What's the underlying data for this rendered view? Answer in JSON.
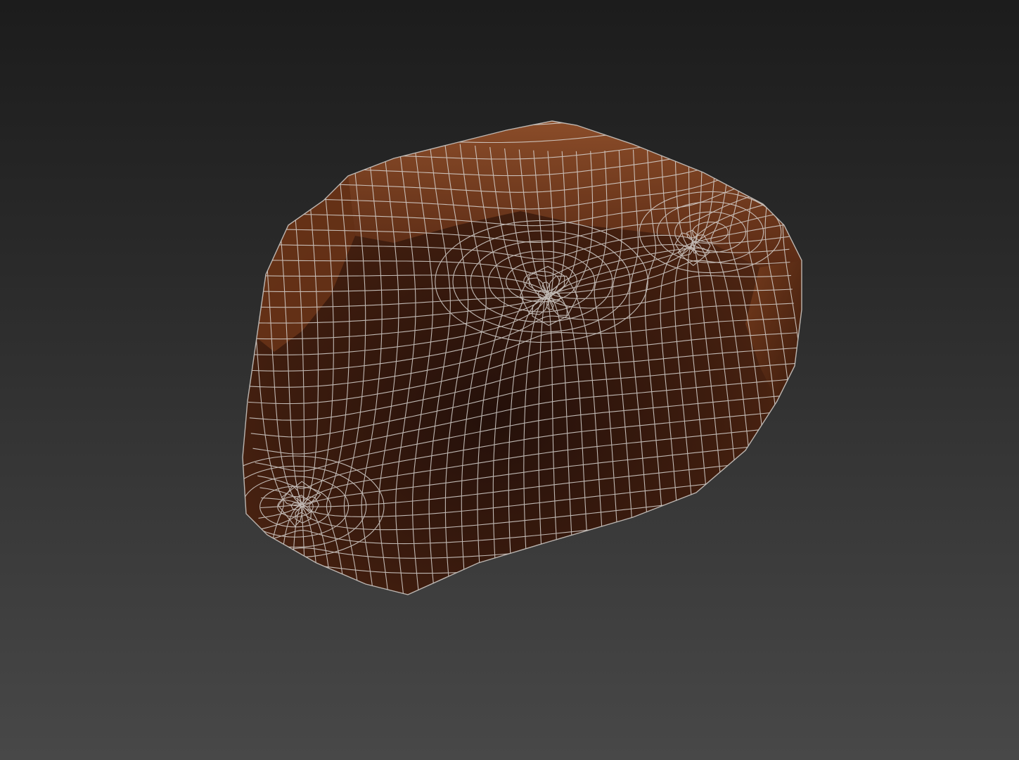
{
  "viewport": {
    "background_top_color": "#1c1c1c",
    "background_bottom_color": "#484848"
  },
  "model": {
    "name": "rock-mesh",
    "shading": "smooth-with-wireframe",
    "base_color": "#4a2210",
    "highlight_color": "#8a4a26",
    "shadow_color": "#1e0c05",
    "wire_color": "#d8d4d0"
  }
}
